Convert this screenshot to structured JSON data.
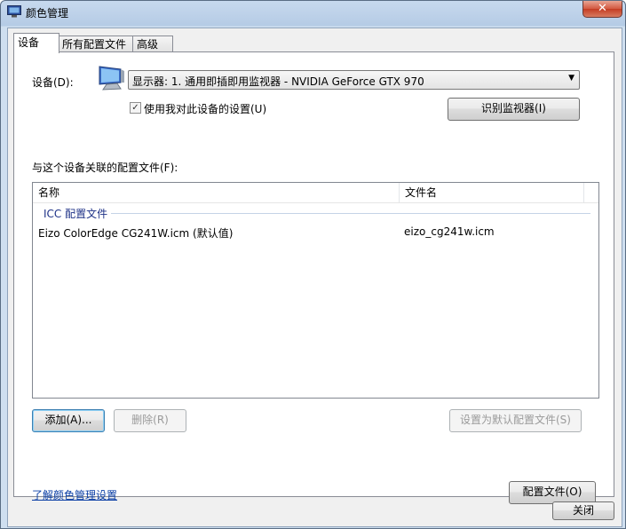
{
  "window": {
    "title": "颜色管理",
    "close_glyph": "✕"
  },
  "tabs": [
    {
      "label": "设备"
    },
    {
      "label": "所有配置文件"
    },
    {
      "label": "高级"
    }
  ],
  "device": {
    "label": "设备(D):",
    "selected": "显示器: 1. 通用即插即用监视器 - NVIDIA GeForce GTX 970",
    "use_settings_checkbox": {
      "label": "使用我对此设备的设置(U)",
      "checked": true
    },
    "identify_button": "识别监视器(I)"
  },
  "profiles": {
    "section_label": "与这个设备关联的配置文件(F):",
    "columns": [
      "名称",
      "文件名"
    ],
    "group_label": "ICC 配置文件",
    "rows": [
      {
        "name": "Eizo ColorEdge CG241W.icm (默认值)",
        "file": "eizo_cg241w.icm"
      }
    ]
  },
  "buttons": {
    "add": "添加(A)...",
    "remove": "删除(R)",
    "set_default": "设置为默认配置文件(S)",
    "profiles": "配置文件(O)",
    "close": "关闭"
  },
  "link": {
    "text": "了解颜色管理设置"
  },
  "icons": {
    "window": "color-management-icon",
    "device": "monitor-icon"
  }
}
